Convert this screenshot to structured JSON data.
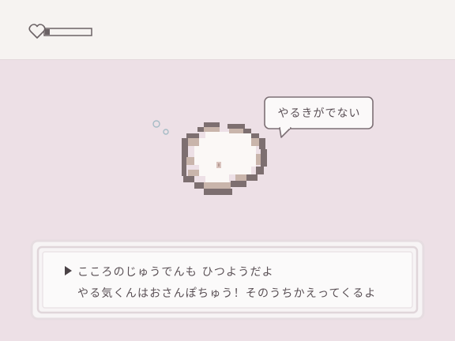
{
  "hud": {
    "heart_icon": "heart-outline-icon",
    "energy_level": 0.1
  },
  "pet": {
    "state": "lying-down",
    "speech": "やるきがでない"
  },
  "dialog": {
    "line1": "こころのじゅうでんも ひつようだよ",
    "line2": "やる気くんはおさんぽちゅう！そのうちかえってくるよ",
    "cursor_icon": "play-arrow-icon"
  },
  "colors": {
    "top_bar": "#f6f3f1",
    "background": "#ede0e6",
    "outline": "#6b6265",
    "pet_outline": "#7d6f70",
    "pet_body": "#fbf8f6",
    "pet_shadow": "#c9b5ab",
    "frame": "#f7f4f5"
  }
}
